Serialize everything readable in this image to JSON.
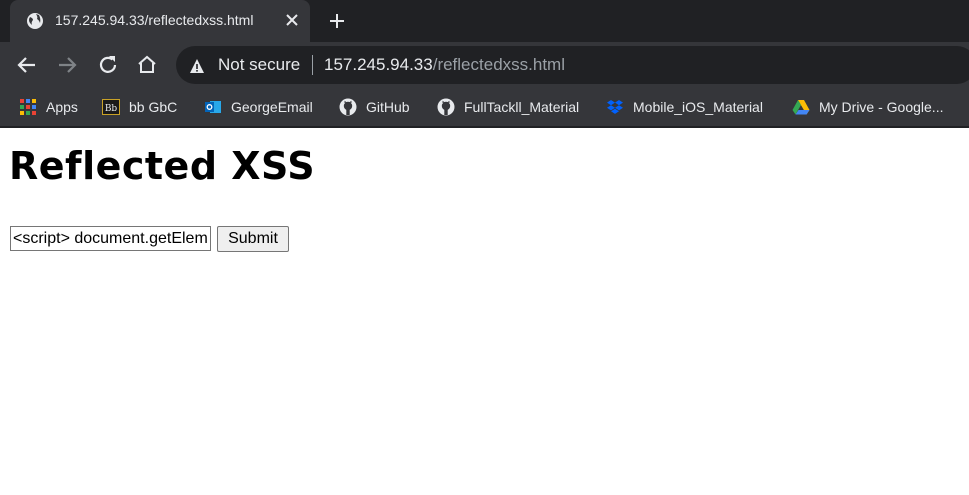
{
  "browser": {
    "tab": {
      "title": "157.245.94.33/reflectedxss.html"
    },
    "address_bar": {
      "security_label": "Not secure",
      "host": "157.245.94.33",
      "path": "/reflectedxss.html"
    },
    "bookmarks": [
      {
        "label": "Apps",
        "icon": "apps-grid-icon"
      },
      {
        "label": "bb GbC",
        "icon": "blackboard-icon"
      },
      {
        "label": "GeorgeEmail",
        "icon": "outlook-icon"
      },
      {
        "label": "GitHub",
        "icon": "github-icon"
      },
      {
        "label": "FullTackll_Material",
        "icon": "github-icon"
      },
      {
        "label": "Mobile_iOS_Material",
        "icon": "dropbox-icon"
      },
      {
        "label": "My Drive - Google...",
        "icon": "google-drive-icon"
      }
    ]
  },
  "page": {
    "heading": "Reflected XSS",
    "form": {
      "input_value": "<script> document.getElementById",
      "submit_label": "Submit"
    }
  },
  "colors": {
    "tab_strip": "#202124",
    "toolbar": "#35363a",
    "text_light": "#e8eaed",
    "text_dim": "#9aa0a6"
  }
}
